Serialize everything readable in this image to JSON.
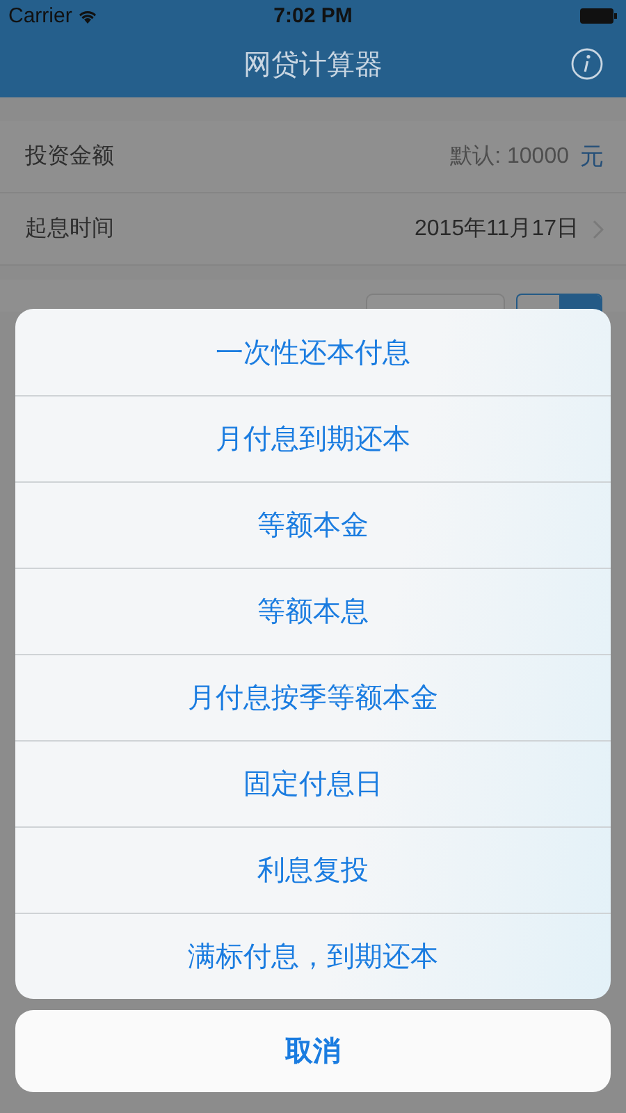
{
  "status_bar": {
    "carrier": "Carrier",
    "time": "7:02 PM"
  },
  "nav_bar": {
    "title": "网贷计算器"
  },
  "form": {
    "rows": [
      {
        "kind": "input",
        "label": "投资金额",
        "placeholder": "默认: 10000",
        "unit": "元"
      },
      {
        "kind": "date",
        "label": "起息时间",
        "value": "2015年11月17日"
      }
    ]
  },
  "action_sheet": {
    "options": [
      "一次性还本付息",
      "月付息到期还本",
      "等额本金",
      "等额本息",
      "月付息按季等额本金",
      "固定付息日",
      "利息复投",
      "满标付息，到期还本"
    ],
    "cancel": "取消"
  }
}
